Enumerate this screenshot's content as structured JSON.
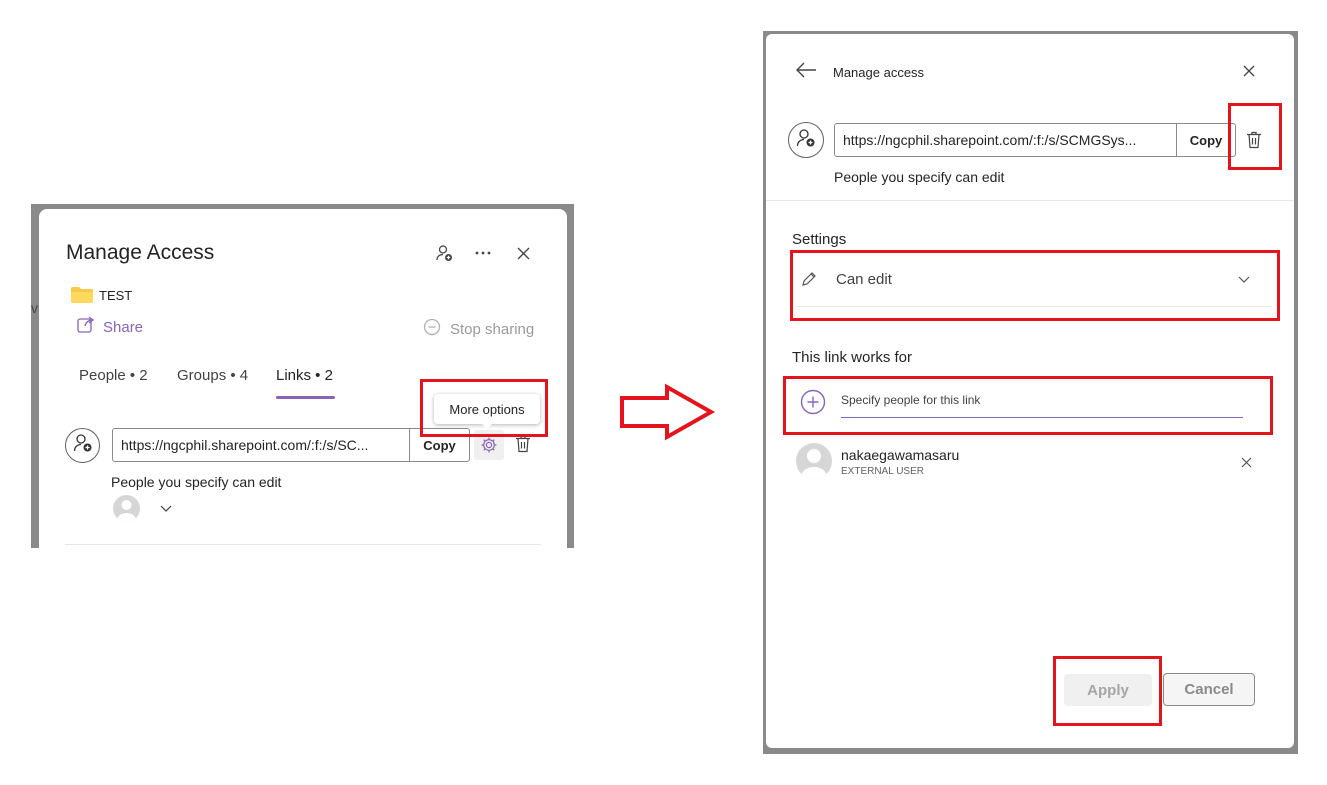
{
  "left_panel": {
    "title": "Manage Access",
    "folder_name": "TEST",
    "share_label": "Share",
    "stop_sharing_label": "Stop sharing",
    "tabs": [
      {
        "label": "People • 2",
        "active": false
      },
      {
        "label": "Groups • 4",
        "active": false
      },
      {
        "label": "Links • 2",
        "active": true
      }
    ],
    "link": {
      "url": "https://ngcphil.sharepoint.com/:f:/s/SC...",
      "copy_label": "Copy",
      "description": "People you specify can edit"
    },
    "tooltip": "More options",
    "cut_letter": "v"
  },
  "right_panel": {
    "title": "Manage access",
    "link": {
      "url": "https://ngcphil.sharepoint.com/:f:/s/SCMGSys...",
      "copy_label": "Copy",
      "description": "People you specify can edit"
    },
    "settings_heading": "Settings",
    "permission_value": "Can edit",
    "link_works_for_heading": "This link works for",
    "specify_placeholder": "Specify people for this link",
    "user": {
      "name": "nakaegawamasaru",
      "role": "EXTERNAL USER"
    },
    "apply_label": "Apply",
    "cancel_label": "Cancel"
  },
  "colors": {
    "accent": "#8764b8",
    "highlight_red": "#e3141d",
    "folder_yellow": "#f7c948"
  }
}
